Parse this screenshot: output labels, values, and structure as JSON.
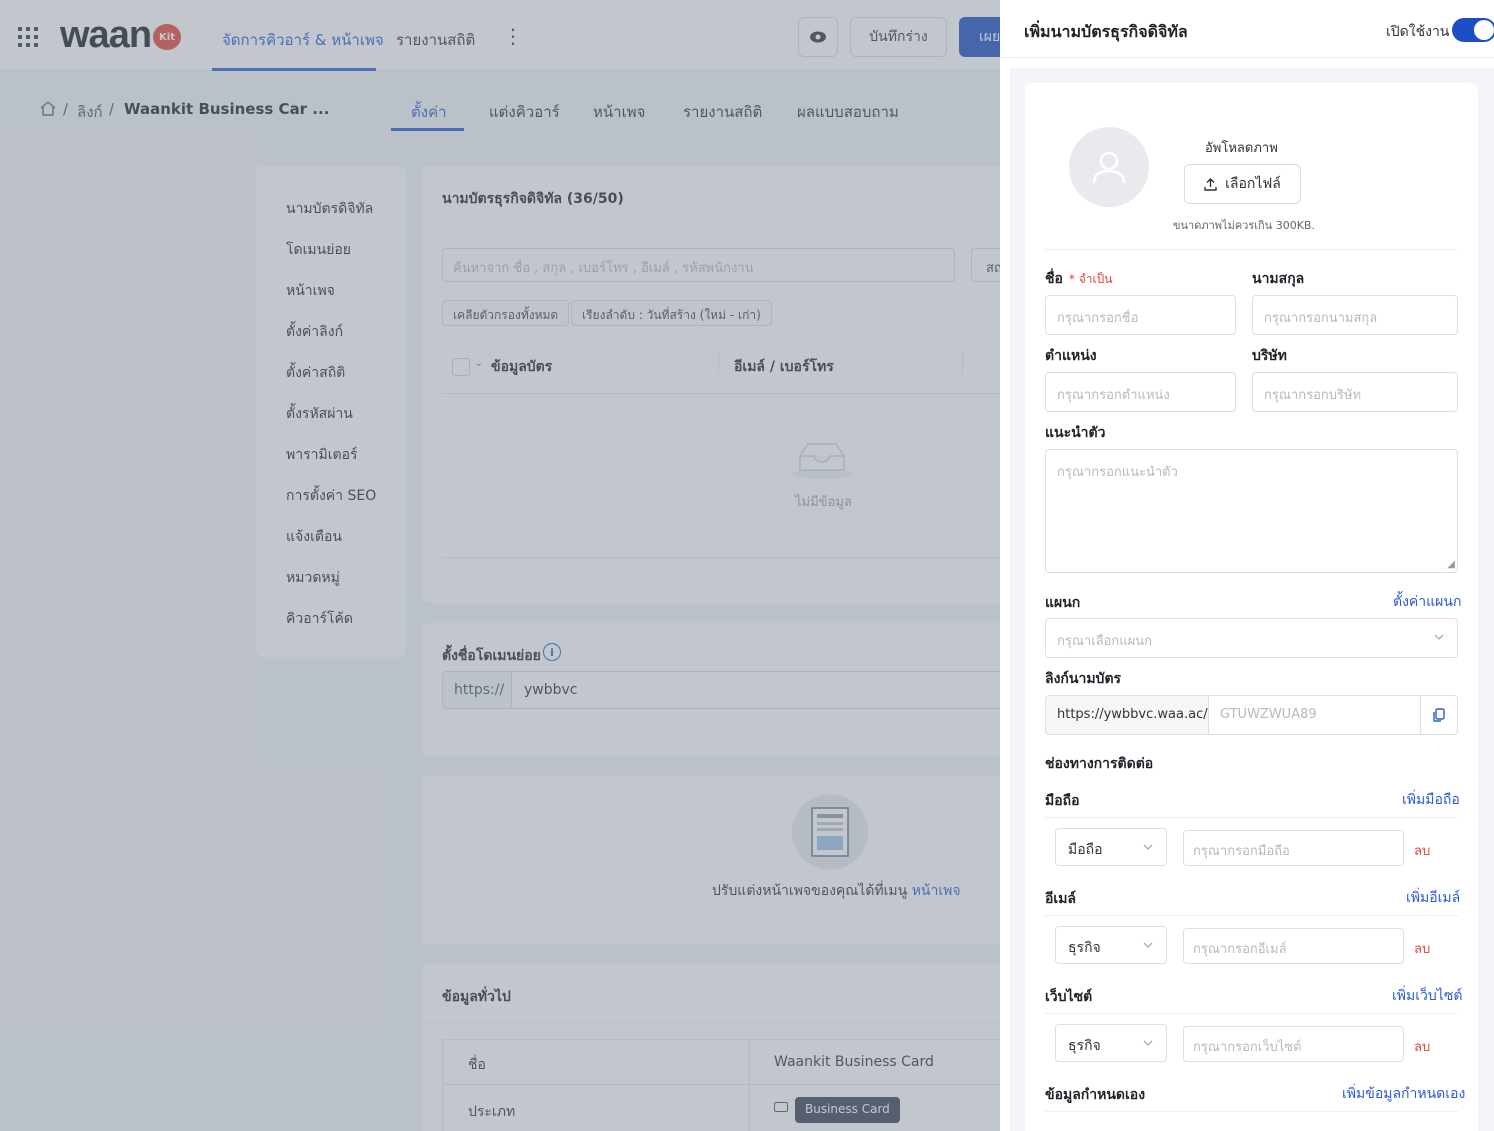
{
  "topbar": {
    "logo_text": "waan",
    "logo_badge": "Kit",
    "nav": [
      {
        "label": "จัดการคิวอาร์ & หน้าเพจ"
      },
      {
        "label": "รายงานสถิติ"
      }
    ],
    "more_label": "⋮",
    "draft_label": "บันทึกร่าง",
    "publish_label": "เผย"
  },
  "breadcrumb": {
    "items": [
      "ลิงก์",
      "Waankit Business Car ..."
    ],
    "separator": "/"
  },
  "subtabs": [
    {
      "label": "ตั้งค่า"
    },
    {
      "label": "แต่งคิวอาร์"
    },
    {
      "label": "หน้าเพจ"
    },
    {
      "label": "รายงานสถิติ"
    },
    {
      "label": "ผลแบบสอบถาม"
    }
  ],
  "leftmenu": [
    {
      "label": "นามบัตรดิจิทัล"
    },
    {
      "label": "โดเมนย่อย"
    },
    {
      "label": "หน้าเพจ"
    },
    {
      "label": "ตั้งค่าลิงก์"
    },
    {
      "label": "ตั้งค่าสถิติ"
    },
    {
      "label": "ตั้งรหัสผ่าน"
    },
    {
      "label": "พารามิเตอร์"
    },
    {
      "label": "การตั้งค่า SEO"
    },
    {
      "label": "แจ้งเตือน"
    },
    {
      "label": "หมวดหมู่"
    },
    {
      "label": "คิวอาร์โค้ด"
    }
  ],
  "cards_list": {
    "title": "นามบัตรธุรกิจดิจิทัล (36/50)",
    "search_placeholder": "ค้นหาจาก ชื่อ , สกุล , เบอร์โทร , อีเมล์ , รหัสพนักงาน",
    "search_side": "สถ",
    "chip_clear": "เคลียตัวกรองทั้งหมด",
    "chip_sort": "เรียงลำดับ : วันที่สร้าง (ใหม่ - เก่า)",
    "col_info": "ข้อมูลบัตร",
    "col_contact": "อีเมล์ / เบอร์โทร",
    "empty_text": "ไม่มีข้อมูล"
  },
  "subdomain": {
    "title": "ตั้งชื่อโดเมนย่อย",
    "info_glyph": "i",
    "prefix": "https://",
    "value": "ywbbvc"
  },
  "promo": {
    "text": "ปรับแต่งหน้าเพจของคุณได้ที่เมนู",
    "link": "หน้าเพจ"
  },
  "general": {
    "title": "ข้อมูลทั่วไป",
    "name_key": "ชื่อ",
    "name_value": "Waankit Business Card",
    "type_key": "ประเภท",
    "type_value": "Business Card"
  },
  "drawer": {
    "title": "เพิ่มนามบัตรธุรกิจดิจิทัล",
    "enable_label": "เปิดใช้งาน",
    "enabled": true,
    "upload_title": "อัพโหลดภาพ",
    "upload_button": "เลือกไฟล์",
    "upload_hint": "ขนาดภาพไม่ควรเกิน 300KB.",
    "first_name_label": "ชื่อ",
    "required_label": "* จำเป็น",
    "first_name_placeholder": "กรุณากรอกชื่อ",
    "last_name_label": "นามสกุล",
    "last_name_placeholder": "กรุณากรอกนามสกุล",
    "position_label": "ตำแหน่ง",
    "position_placeholder": "กรุณากรอกตำแหน่ง",
    "company_label": "บริษัท",
    "company_placeholder": "กรุณากรอกบริษัท",
    "bio_label": "แนะนำตัว",
    "bio_placeholder": "กรุณากรอกแนะนำตัว",
    "dept_label": "แผนก",
    "dept_settings_link": "ตั้งค่าแผนก",
    "dept_placeholder": "กรุณาเลือกแผนก",
    "card_link_label": "ลิงก์นามบัตร",
    "card_link_prefix": "https://ywbbvc.waa.ac/",
    "card_link_code": "GTUWZWUA89",
    "contact_section": "ช่องทางการติดต่อ",
    "mobile": {
      "label": "มือถือ",
      "add_link": "เพิ่มมือถือ",
      "type": "มือถือ",
      "placeholder": "กรุณากรอกมือถือ",
      "delete": "ลบ"
    },
    "email": {
      "label": "อีเมล์",
      "add_link": "เพิ่มอีเมล์",
      "type": "ธุรกิจ",
      "placeholder": "กรุณากรอกอีเมล์",
      "delete": "ลบ"
    },
    "website": {
      "label": "เว็บไซต์",
      "add_link": "เพิ่มเว็บไซต์",
      "type": "ธุรกิจ",
      "placeholder": "กรุณากรอกเว็บไซต์",
      "delete": "ลบ"
    },
    "custom_label": "ข้อมูลกำหนดเอง",
    "custom_add_link": "เพิ่มข้อมูลกำหนดเอง"
  },
  "colors": {
    "primary": "#1d4fc4",
    "link": "#2a5bd7",
    "danger": "#e0443c",
    "logo_badge": "#e8443c"
  },
  "icons": [
    "grid-icon",
    "eye-icon",
    "home-icon",
    "info-icon",
    "empty-inbox-icon",
    "avatar-user-icon",
    "upload-icon",
    "chevron-down-icon",
    "copy-icon",
    "card-icon"
  ]
}
